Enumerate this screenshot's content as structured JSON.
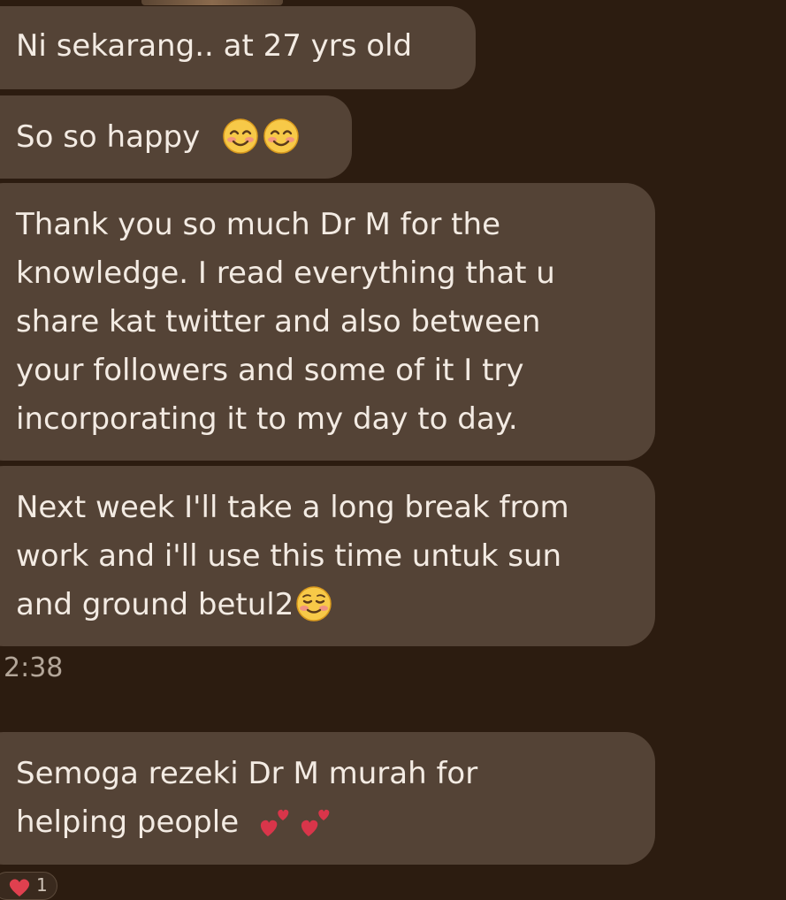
{
  "messages": [
    {
      "lines": [
        "Ni sekarang.. at 27 yrs old"
      ]
    },
    {
      "lines": [
        "So so happy"
      ],
      "emoji": [
        "smiling-face-with-smiling-eyes",
        "smiling-face-with-smiling-eyes"
      ]
    },
    {
      "lines": [
        "Thank you so much Dr M for the",
        "knowledge. I read everything that u",
        "share kat twitter and also between",
        "your followers and some of it I try",
        "incorporating it to my day to day."
      ]
    },
    {
      "lines": [
        "Next week I'll take a long break from",
        "work and i'll use this time untuk sun",
        "and ground betul2"
      ],
      "emoji": [
        "smiling-face"
      ]
    },
    {
      "lines": [
        "Semoga rezeki Dr M murah for",
        "helping people"
      ],
      "emoji": [
        "two-hearts",
        "two-hearts"
      ]
    }
  ],
  "timestamp": "2:38",
  "reaction": {
    "icon": "heart-icon",
    "count": "1"
  },
  "colors": {
    "background": "#2c1c10",
    "bubble": "#544336",
    "text": "#f3ebe3",
    "timestamp": "#b3a699"
  }
}
